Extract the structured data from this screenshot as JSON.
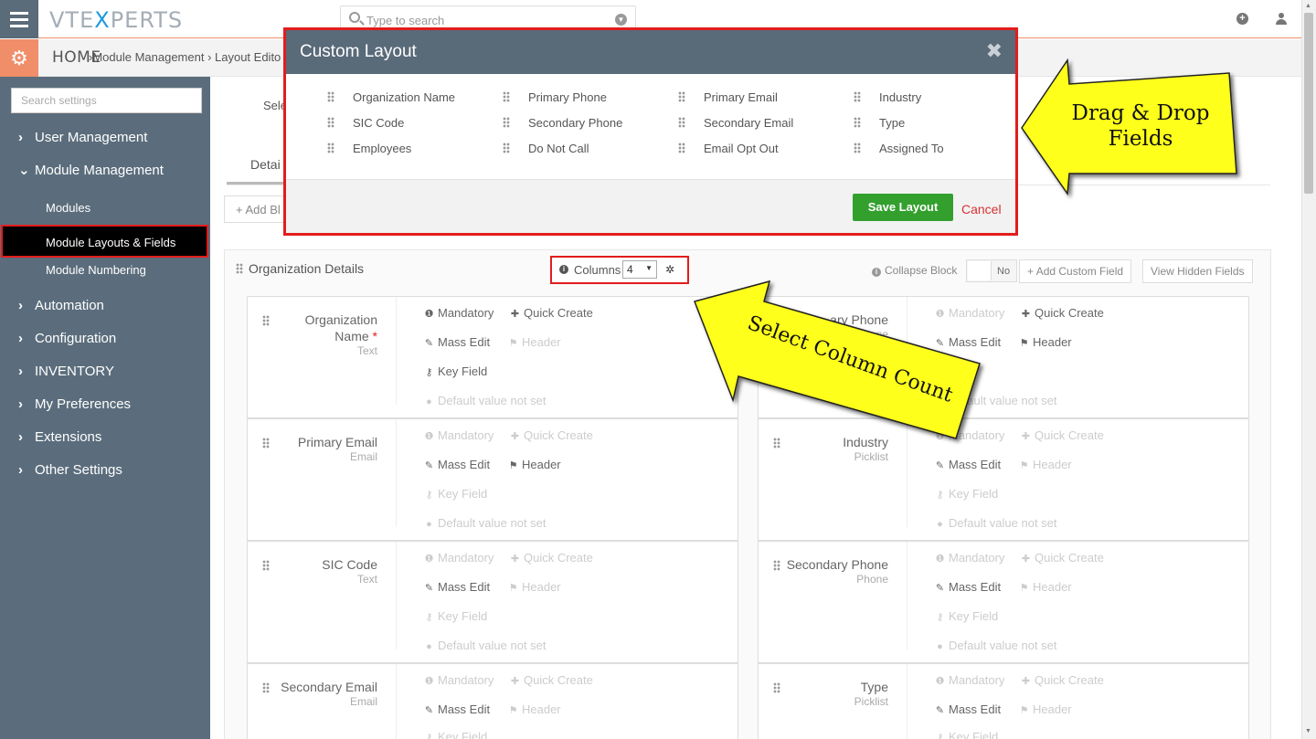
{
  "app": {
    "logo_left": "VTE",
    "logo_x": "X",
    "logo_right": "PERTS",
    "search_placeholder": "Type to search"
  },
  "breadcrumb": {
    "home": "HOME",
    "path": "›Module Management › Layout Edito"
  },
  "sidebar": {
    "search_placeholder": "Search settings",
    "items": [
      {
        "label": "User Management"
      },
      {
        "label": "Module Management"
      },
      {
        "label": "Automation"
      },
      {
        "label": "Configuration"
      },
      {
        "label": "INVENTORY"
      },
      {
        "label": "My Preferences"
      },
      {
        "label": "Extensions"
      },
      {
        "label": "Other Settings"
      }
    ],
    "sub_items": [
      {
        "label": "Modules"
      },
      {
        "label": "Module Layouts & Fields"
      },
      {
        "label": "Module Numbering"
      }
    ]
  },
  "main": {
    "select_label": "Sele",
    "tab_details": "Detai",
    "add_block": "Add Bl",
    "block": {
      "title": "Organization Details",
      "columns_label": "Columns",
      "columns_value": "4",
      "collapse_label": "Collapse Block",
      "collapse_value": "No",
      "add_custom_field": "Add Custom Field",
      "view_hidden_fields": "View Hidden Fields"
    },
    "options": {
      "mandatory": "Mandatory",
      "quick_create": "Quick Create",
      "mass_edit": "Mass Edit",
      "header": "Header",
      "key_field": "Key Field",
      "default_value": "Default value not set"
    },
    "fields": [
      {
        "name_line1": "Organization",
        "name_line2": "Name",
        "required": "*",
        "type": "Text"
      },
      {
        "name_line1": "ary Phone",
        "type": "ne"
      },
      {
        "name_line1": "Primary Email",
        "type": "Email"
      },
      {
        "name_line1": "Industry",
        "type": "Picklist"
      },
      {
        "name_line1": "SIC Code",
        "type": "Text"
      },
      {
        "name_line1": "Secondary Phone",
        "type": "Phone"
      },
      {
        "name_line1": "Secondary Email",
        "type": "Email"
      },
      {
        "name_line1": "Type",
        "type": "Picklist"
      }
    ]
  },
  "modal": {
    "title": "Custom Layout",
    "close": "✖",
    "fields": [
      [
        "Organization Name",
        "Primary Phone",
        "Primary Email",
        "Industry"
      ],
      [
        "SIC Code",
        "Secondary Phone",
        "Secondary Email",
        "Type"
      ],
      [
        "Employees",
        "Do Not Call",
        "Email Opt Out",
        "Assigned To"
      ]
    ],
    "save_label": "Save Layout",
    "cancel_label": "Cancel"
  },
  "callouts": {
    "drag_line1": "Drag & Drop",
    "drag_line2": "Fields",
    "select_columns": "Select Column Count"
  },
  "colors": {
    "sidebar": "#5b6d7c",
    "accent": "#f08e6a",
    "highlight_border": "#e31c1c",
    "save_green": "#33a02e",
    "callout_yellow": "#ffff1e"
  }
}
